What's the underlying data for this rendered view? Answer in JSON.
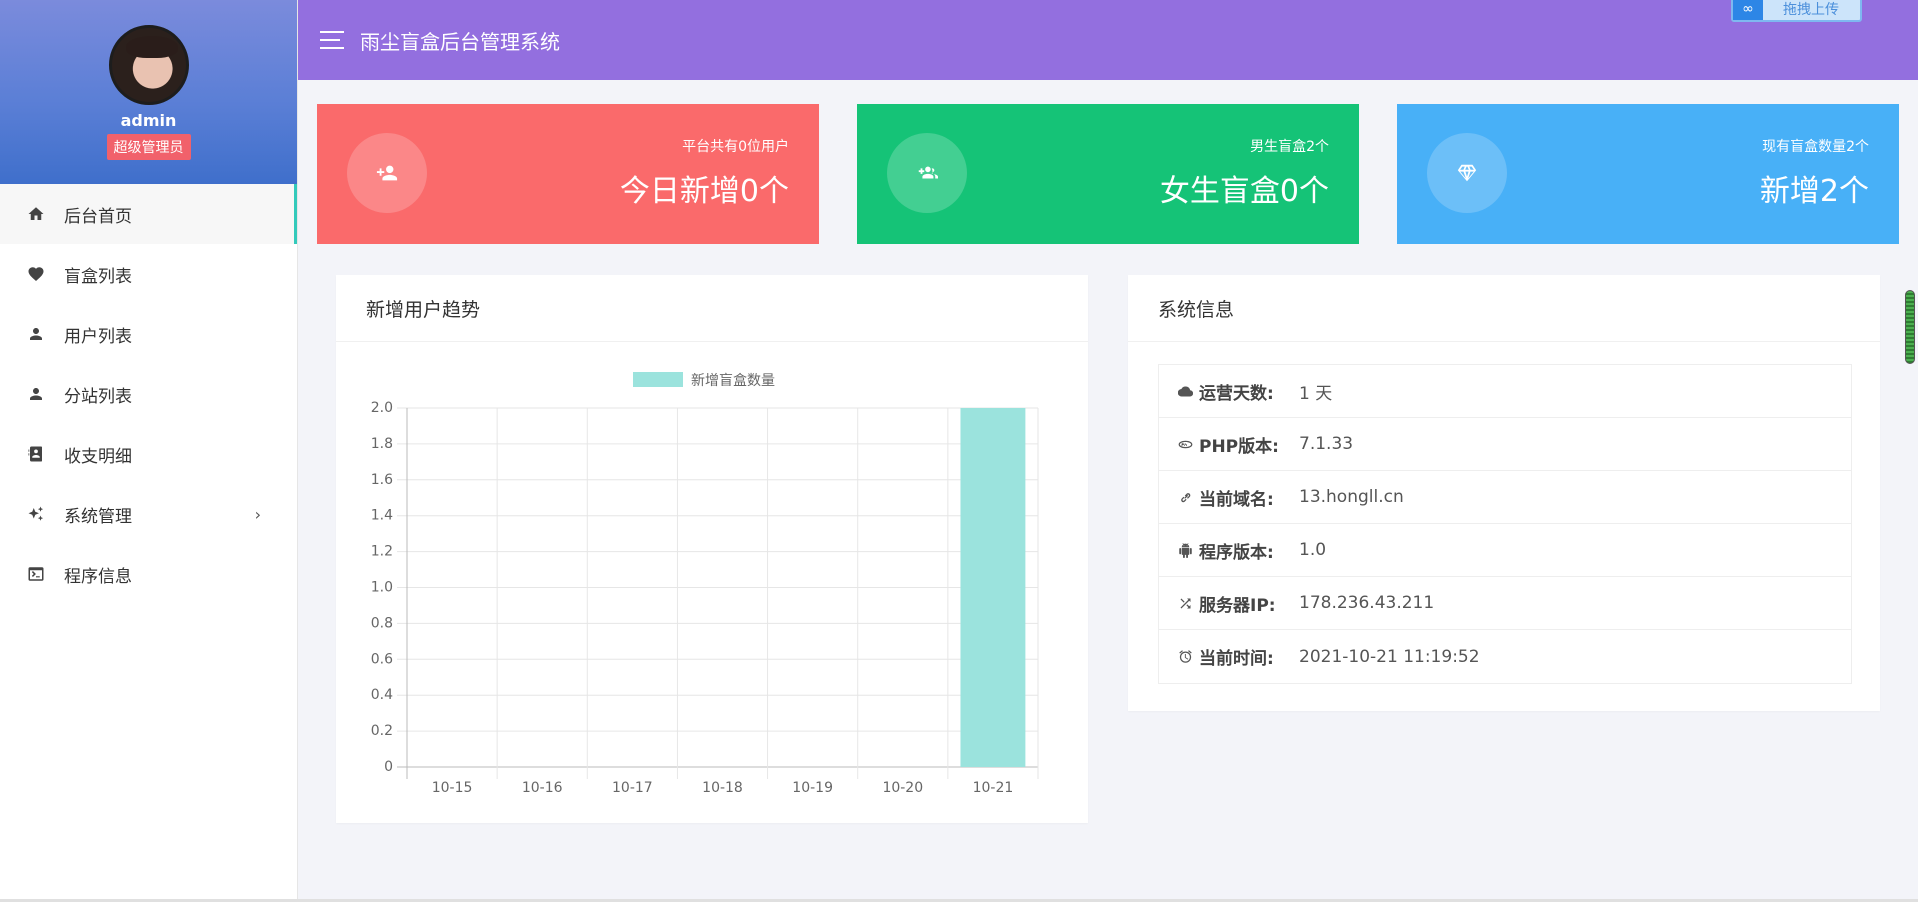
{
  "sidebar": {
    "username": "admin",
    "role": "超级管理员",
    "items": [
      {
        "label": "后台首页",
        "icon": "home-icon",
        "active": true
      },
      {
        "label": "盲盒列表",
        "icon": "heart-icon"
      },
      {
        "label": "用户列表",
        "icon": "user-icon"
      },
      {
        "label": "分站列表",
        "icon": "user-icon"
      },
      {
        "label": "收支明细",
        "icon": "contacts-icon"
      },
      {
        "label": "系统管理",
        "icon": "sparkle-icon",
        "has_submenu": true
      },
      {
        "label": "程序信息",
        "icon": "console-icon"
      }
    ]
  },
  "header": {
    "title": "雨尘盲盒后台管理系统",
    "upload_label": "拖拽上传"
  },
  "stats": [
    {
      "sub": "平台共有0位用户",
      "main": "今日新增0个",
      "color": "#fa6a6b",
      "icon": "user-plus-icon"
    },
    {
      "sub": "男生盲盒2个",
      "main": "女生盲盒0个",
      "color": "#15c377",
      "icon": "users-plus-icon"
    },
    {
      "sub": "现有盲盒数量2个",
      "main": "新增2个",
      "color": "#48b0f7",
      "icon": "diamond-icon"
    }
  ],
  "chart_panel": {
    "title": "新增用户趋势"
  },
  "chart_data": {
    "type": "bar",
    "categories": [
      "10-15",
      "10-16",
      "10-17",
      "10-18",
      "10-19",
      "10-20",
      "10-21"
    ],
    "series": [
      {
        "name": "新增盲盒数量",
        "values": [
          0,
          0,
          0,
          0,
          0,
          0,
          2
        ],
        "color": "#9be3dd"
      }
    ],
    "ylim": [
      0,
      2.0
    ],
    "yticks": [
      "0",
      "0.2",
      "0.4",
      "0.6",
      "0.8",
      "1.0",
      "1.2",
      "1.4",
      "1.6",
      "1.8",
      "2.0"
    ],
    "grid": true,
    "legend": "top-center"
  },
  "system_panel": {
    "title": "系统信息",
    "rows": [
      {
        "icon": "cloud-icon",
        "label": "运营天数:",
        "value": "1 天"
      },
      {
        "icon": "php-icon",
        "label": "PHP版本:",
        "value": "7.1.33"
      },
      {
        "icon": "link-icon",
        "label": "当前域名:",
        "value": "13.hongll.cn"
      },
      {
        "icon": "android-icon",
        "label": "程序版本:",
        "value": "1.0"
      },
      {
        "icon": "shuffle-icon",
        "label": "服务器IP:",
        "value": "178.236.43.211"
      },
      {
        "icon": "alarm-icon",
        "label": "当前时间:",
        "value": "2021-10-21 11:19:52"
      }
    ]
  }
}
